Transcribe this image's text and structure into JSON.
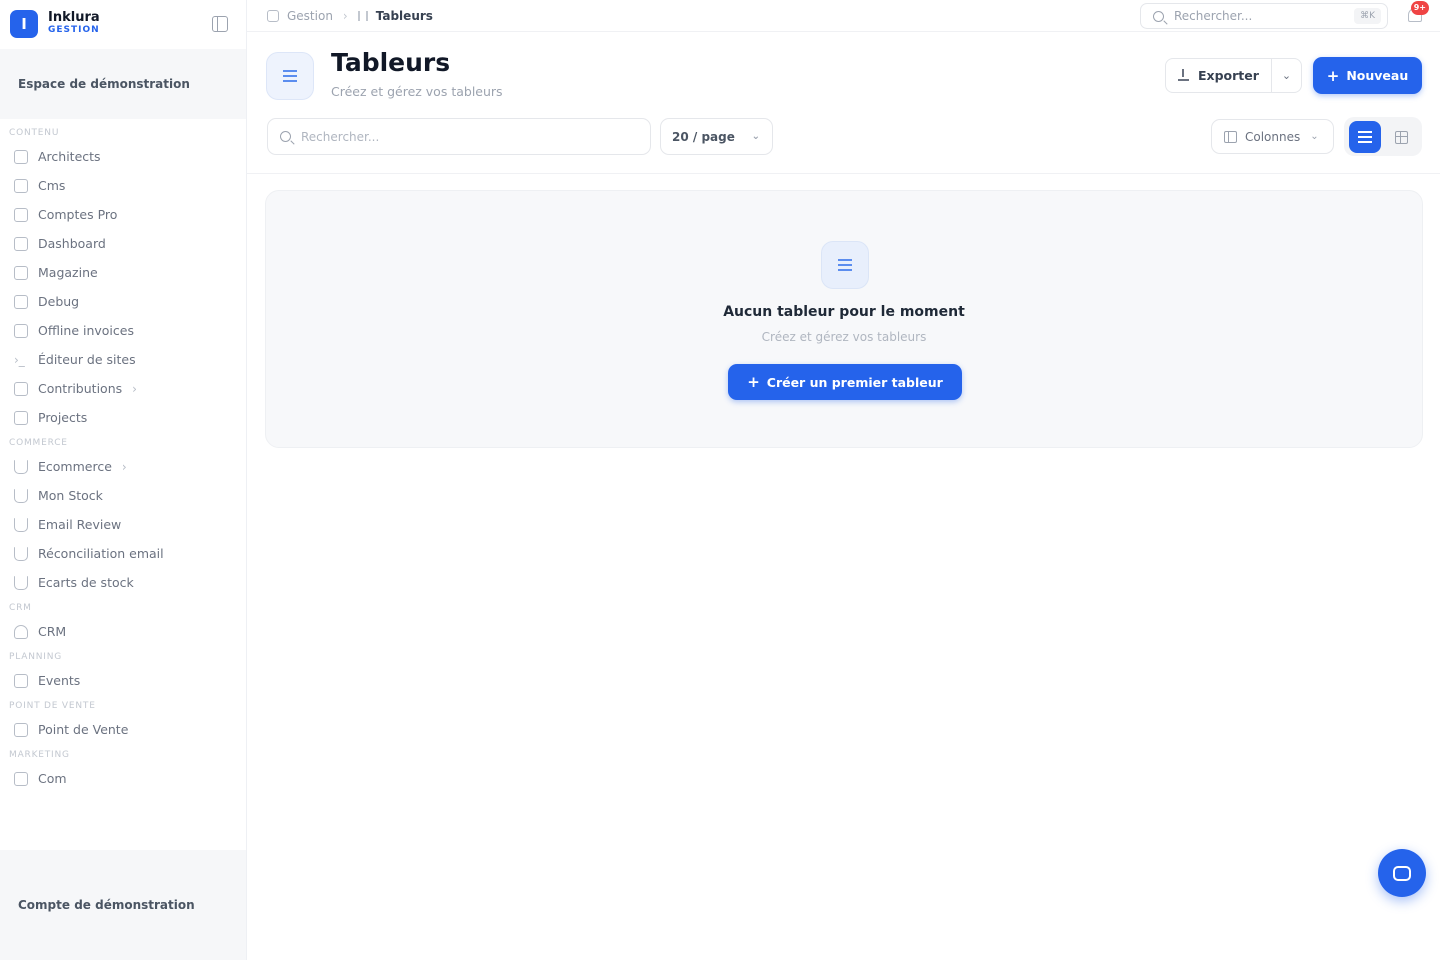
{
  "brand": {
    "name": "Inklura",
    "sub": "GESTION"
  },
  "sidebar": {
    "workspace": "Espace de démonstration",
    "account": "Compte de démonstration",
    "sections": [
      {
        "label": "CONTENU",
        "items": [
          {
            "label": "Architects",
            "icon": "document-icon"
          },
          {
            "label": "Cms",
            "icon": "document-icon"
          },
          {
            "label": "Comptes Pro",
            "icon": "document-icon"
          },
          {
            "label": "Dashboard",
            "icon": "table-icon"
          },
          {
            "label": "Magazine",
            "icon": "table-icon"
          },
          {
            "label": "Debug",
            "icon": "table-icon"
          },
          {
            "label": "Offline invoices",
            "icon": "table-icon"
          },
          {
            "label": "Éditeur de sites",
            "icon": "terminal-icon"
          },
          {
            "label": "Contributions",
            "icon": "inbox-icon",
            "chevron": true
          },
          {
            "label": "Projects",
            "icon": "folder-icon"
          }
        ]
      },
      {
        "label": "COMMERCE",
        "items": [
          {
            "label": "Ecommerce",
            "icon": "cart-icon",
            "chevron": true
          },
          {
            "label": "Mon Stock",
            "icon": "cart-icon"
          },
          {
            "label": "Email Review",
            "icon": "cart-icon"
          },
          {
            "label": "Réconciliation email",
            "icon": "cart-icon"
          },
          {
            "label": "Ecarts de stock",
            "icon": "cart-icon"
          }
        ]
      },
      {
        "label": "CRM",
        "items": [
          {
            "label": "CRM",
            "icon": "user-icon"
          }
        ]
      },
      {
        "label": "PLANNING",
        "items": [
          {
            "label": "Events",
            "icon": "calendar-icon"
          }
        ]
      },
      {
        "label": "POINT DE VENTE",
        "items": [
          {
            "label": "Point de Vente",
            "icon": "store-icon"
          }
        ]
      },
      {
        "label": "MARKETING",
        "items": [
          {
            "label": "Com",
            "icon": "megaphone-icon"
          }
        ]
      }
    ]
  },
  "topbar": {
    "breadcrumb_root": "Gestion",
    "breadcrumb_current": "Tableurs",
    "search_placeholder": "Rechercher...",
    "shortcut": "⌘K",
    "notifications_count": "9+"
  },
  "page": {
    "title": "Tableurs",
    "subtitle": "Créez et gérez vos tableurs",
    "export_label": "Exporter",
    "new_label": "Nouveau",
    "search_placeholder": "Rechercher...",
    "per_page": "20 / page",
    "columns_label": "Colonnes"
  },
  "empty_state": {
    "title": "Aucun tableur pour le moment",
    "subtitle": "Créez et gérez vos tableurs",
    "cta": "Créer un premier tableur"
  },
  "colors": {
    "accent": "#2563eb",
    "badge": "#ef4444"
  }
}
